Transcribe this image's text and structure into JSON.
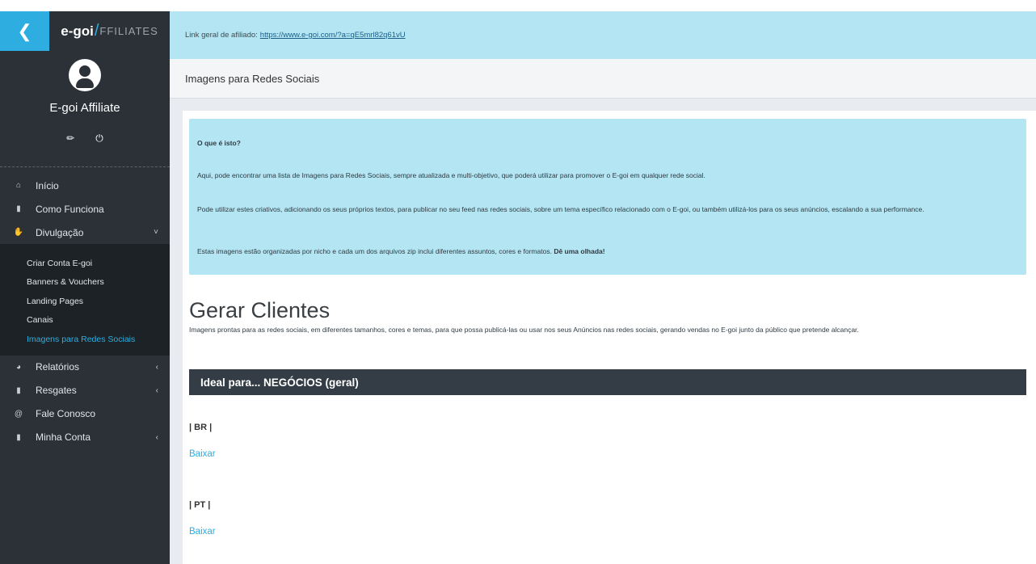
{
  "sidebar": {
    "back_icon": "chevron-left-icon",
    "logo": {
      "brand": "e-goi",
      "slash": "/",
      "suffix": "FFILIATES"
    },
    "profile": {
      "name": "E-goi Affiliate",
      "edit_icon": "pencil-icon",
      "power_icon": "power-icon"
    },
    "menu": [
      {
        "label": "Início",
        "icon": "home-icon"
      },
      {
        "label": "Como Funciona",
        "icon": "book-icon"
      },
      {
        "label": "Divulgação",
        "icon": "handshake-icon",
        "chevron": "˅"
      }
    ],
    "submenu": [
      {
        "label": "Criar Conta E-goi"
      },
      {
        "label": "Banners & Vouchers"
      },
      {
        "label": "Landing Pages"
      },
      {
        "label": "Canais"
      },
      {
        "label": "Imagens para Redes Sociais",
        "active": true
      }
    ],
    "menu2": [
      {
        "label": "Relatórios",
        "icon": "chart-icon",
        "chevron": "‹"
      },
      {
        "label": "Resgates",
        "icon": "book-icon",
        "chevron": "‹"
      },
      {
        "label": "Fale Conosco",
        "icon": "at-icon"
      },
      {
        "label": "Minha Conta",
        "icon": "book-icon",
        "chevron": "‹"
      }
    ]
  },
  "header": {
    "affiliate_label": "Link geral de afiliado:",
    "affiliate_link": "https://www.e-goi.com/?a=qE5mrl82q61vU",
    "page_title": "Imagens para Redes Sociais"
  },
  "info": {
    "question": "O que é isto?",
    "p1": "Aqui, pode encontrar uma lista de Imagens para Redes Sociais, sempre atualizada e multi-objetivo, que poderá utilizar para promover o E-goi em qualquer rede social.",
    "p2": "Pode utilizar estes criativos, adicionando os seus próprios textos, para publicar no seu feed nas redes sociais, sobre um tema específico relacionado com o E-goi, ou também utilizá-los para os seus anúncios, escalando a sua performance.",
    "p3": "Estas imagens estão organizadas por nicho e cada um dos arquivos zip inclui diferentes assuntos, cores e formatos.",
    "p3_bold": "Dê uma olhada!"
  },
  "section": {
    "title": "Gerar Clientes",
    "lead": "Imagens prontas para as redes sociais, em diferentes tamanhos, cores e temas, para que possa publicá-las ou usar nos seus Anúncios nas redes sociais, gerando vendas no E-goi junto da público que pretende alcançar.",
    "bar": "Ideal para... NEGÓCIOS (geral)",
    "downloads": [
      {
        "lang": "| BR |",
        "link": "Baixar"
      },
      {
        "lang": "| PT |",
        "link": "Baixar"
      }
    ]
  }
}
